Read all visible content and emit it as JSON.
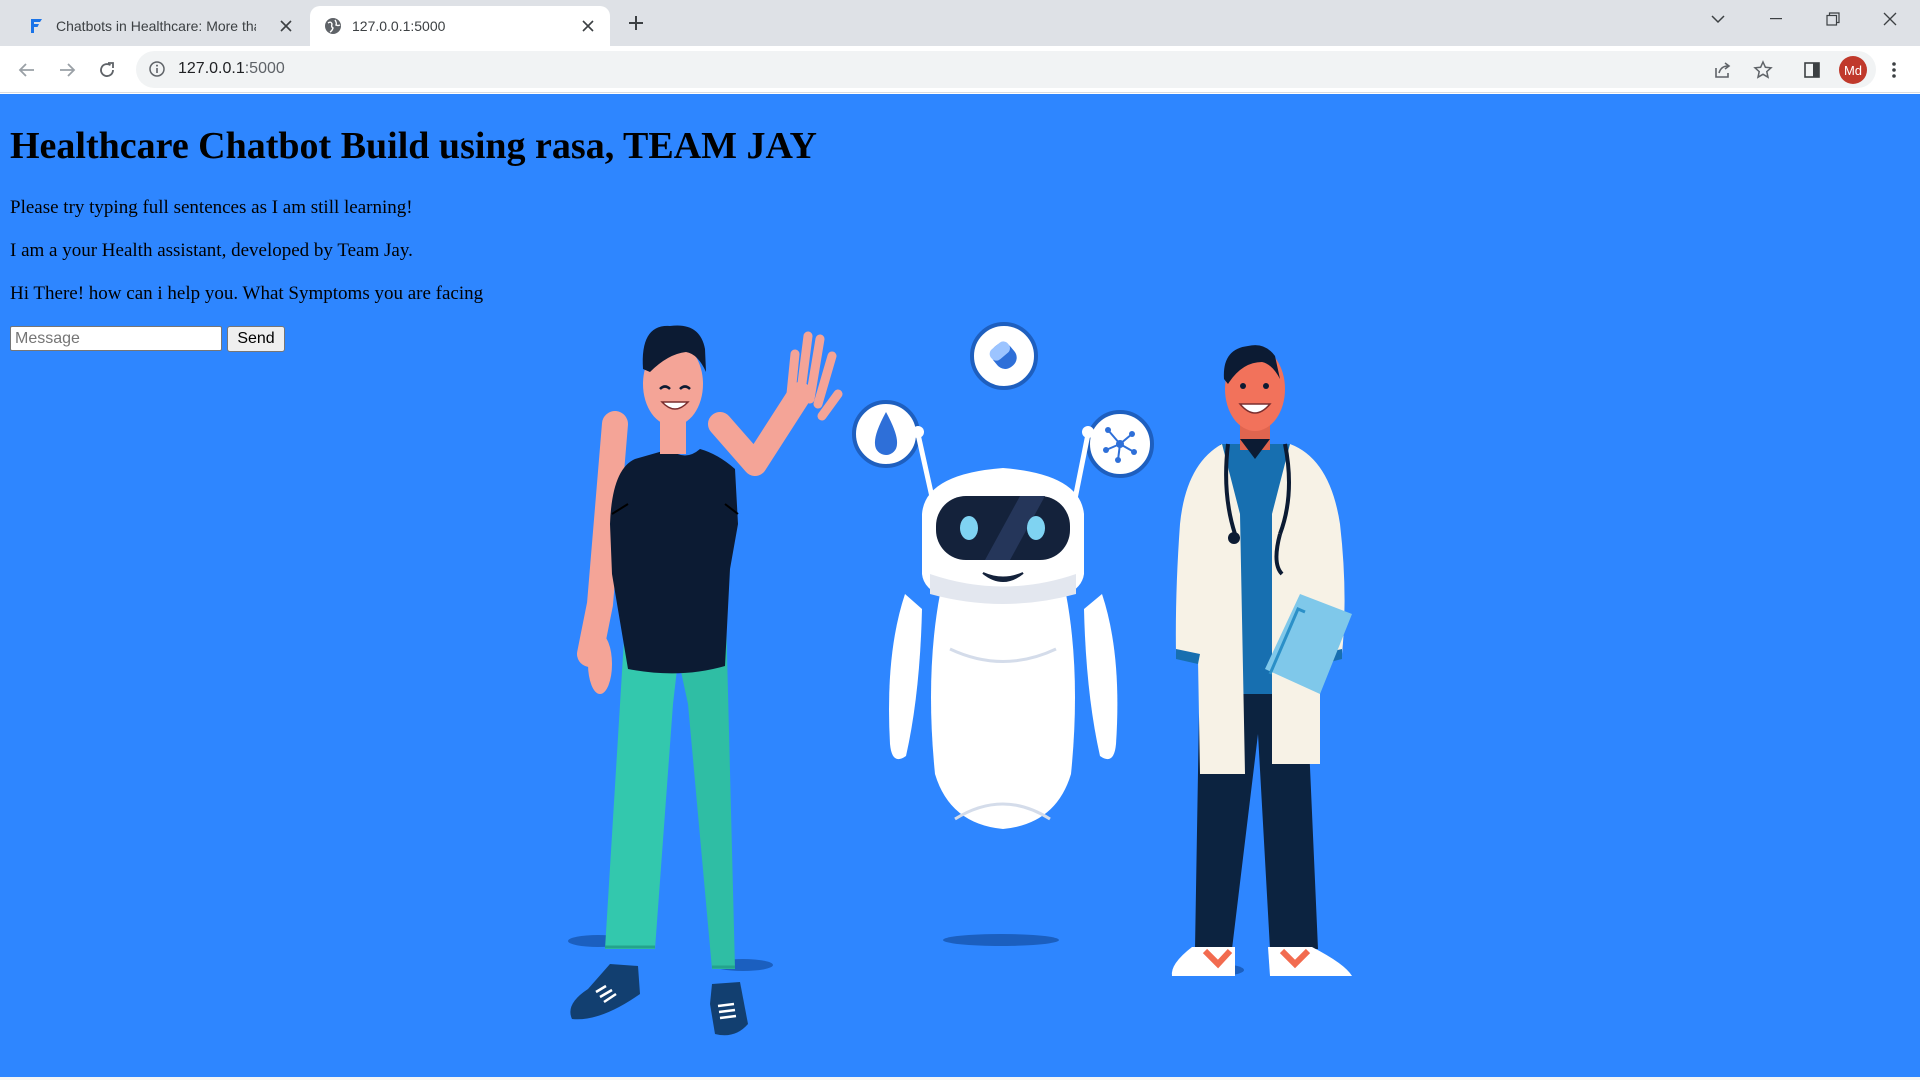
{
  "browser": {
    "tabs": [
      {
        "title": "Chatbots in Healthcare: More tha",
        "active": false
      },
      {
        "title": "127.0.0.1:5000",
        "active": true
      }
    ],
    "address_bar": {
      "url_host": "127.0.0.1",
      "url_port": ":5000"
    },
    "profile_initials": "Md",
    "profile_color": "#c0392b"
  },
  "page": {
    "background_color": "#2e86ff",
    "title": "Healthcare Chatbot Build using rasa, TEAM JAY",
    "messages": [
      "Please try typing full sentences as I am still learning!",
      "I am a your Health assistant, developed by Team Jay.",
      "Hi There! how can i help you. What Symptoms you are facing"
    ],
    "input": {
      "placeholder": "Message",
      "value": ""
    },
    "send_label": "Send"
  },
  "icons": {
    "tab_favicon_1": "document-icon",
    "tab_favicon_2": "globe-icon",
    "back": "arrow-left-icon",
    "forward": "arrow-right-icon",
    "reload": "reload-icon",
    "site_info": "info-icon",
    "share": "share-icon",
    "bookmark": "star-icon",
    "side_panel": "side-panel-icon",
    "menu": "kebab-menu-icon",
    "illustration": "healthcare-robot-illustration"
  }
}
